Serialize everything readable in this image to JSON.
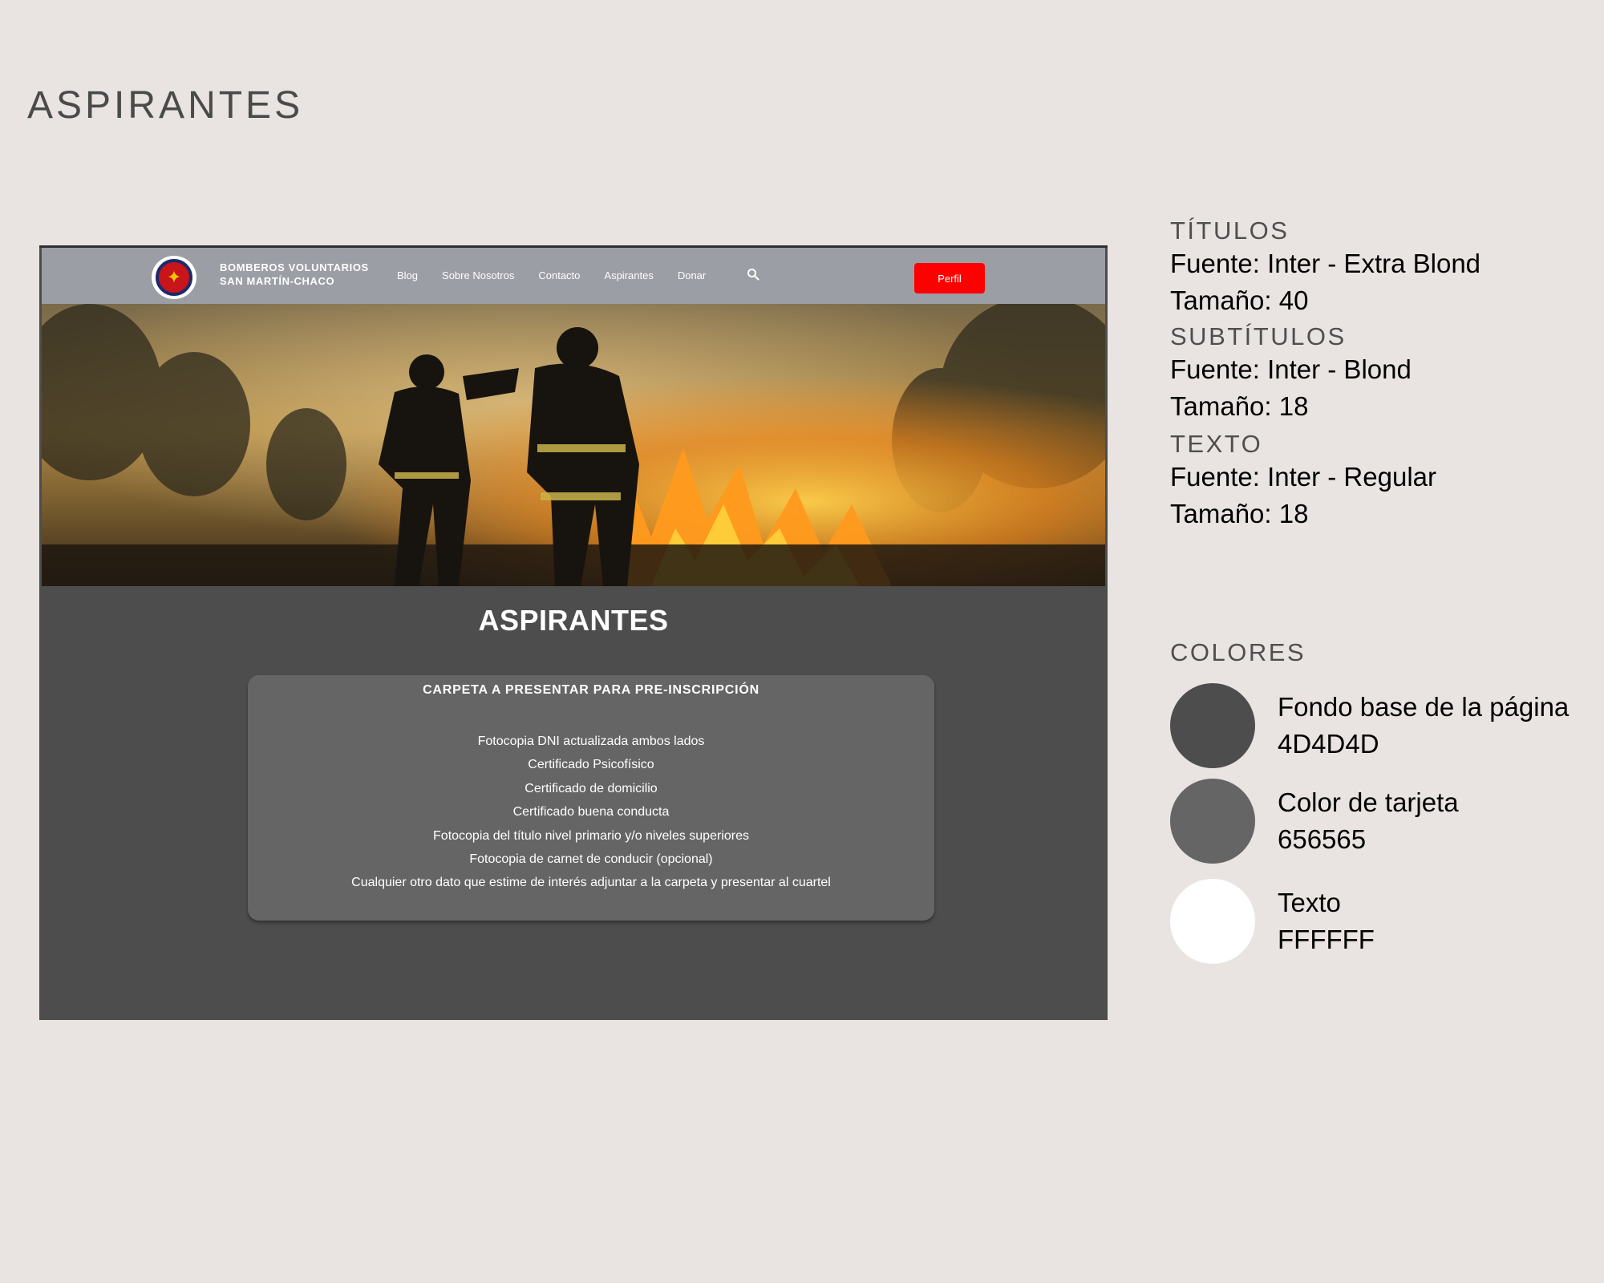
{
  "page": {
    "heading": "ASPIRANTES"
  },
  "site": {
    "brand_line1": "BOMBEROS VOLUNTARIOS",
    "brand_line2": "SAN MARTÍN-CHACO",
    "nav": [
      "Blog",
      "Sobre Nosotros",
      "Contacto",
      "Aspirantes",
      "Donar"
    ],
    "search_icon": "search-icon",
    "profile_label": "Perfil",
    "section_title": "ASPIRANTES",
    "card": {
      "title": "CARPETA A PRESENTAR PARA PRE-INSCRIPCIÓN",
      "items": [
        "Fotocopia DNI actualizada ambos lados",
        "Certificado Psicofísico",
        "Certificado de domicilio",
        "Certificado buena conducta",
        "Fotocopia del título nivel primario y/o niveles superiores",
        "Fotocopia de carnet de conducir (opcional)",
        "Cualquier otro dato que estime de interés adjuntar a la carpeta y presentar al cuartel"
      ]
    }
  },
  "spec": {
    "titles": {
      "heading": "TÍTULOS",
      "font": "Fuente: Inter - Extra Blond",
      "size": "Tamaño: 40"
    },
    "subtitles": {
      "heading": "SUBTÍTULOS",
      "font": "Fuente: Inter - Blond",
      "size": "Tamaño: 18"
    },
    "text": {
      "heading": "TEXTO",
      "font": "Fuente: Inter - Regular",
      "size": "Tamaño: 18"
    },
    "colors": {
      "heading": "COLORES",
      "swatches": [
        {
          "label": "Fondo base de la página",
          "code": "4D4D4D",
          "hex": "#4d4d4d"
        },
        {
          "label": "Color de tarjeta",
          "code": "656565",
          "hex": "#656565"
        },
        {
          "label": "Texto",
          "code": "FFFFFF",
          "hex": "#ffffff"
        }
      ]
    }
  },
  "colors": {
    "nav_bg": "#9c9ea5",
    "profile_button": "#ff0000",
    "page_bg": "#e9e4e1"
  }
}
